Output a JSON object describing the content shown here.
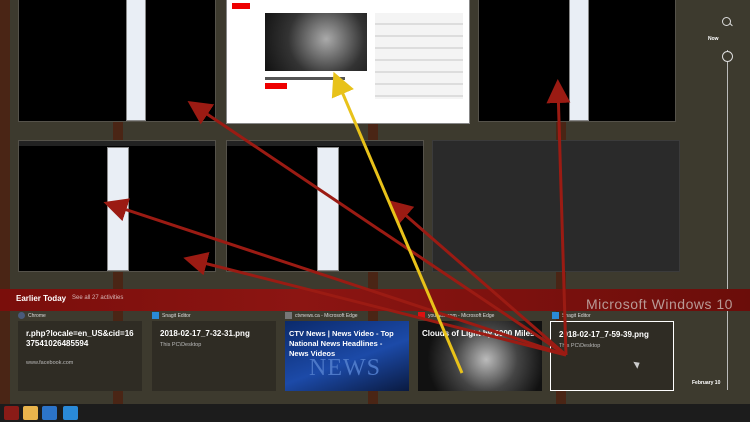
{
  "earlier_today": {
    "title": "Earlier Today",
    "see_all": "See all 27 activities",
    "brand": "Microsoft Windows 10"
  },
  "activities": [
    {
      "app": "Chrome",
      "title": "r.php?locale=en_US&cid=1637541026485594",
      "subtitle": "www.facebook.com"
    },
    {
      "app": "Snagit Editor",
      "title": "2018-02-17_7-32-31.png",
      "subtitle": "This PC\\Desktop"
    },
    {
      "app": "ctvnews.ca - Microsoft Edge",
      "title": "CTV News | News Video - Top National News Headlines - News Videos",
      "subtitle": ""
    },
    {
      "app": "youtube.com - Microsoft Edge",
      "title": "Clouds of Light by 6000 Miles",
      "subtitle": ""
    },
    {
      "app": "Snagit Editor",
      "title": "2018-02-17_7-59-39.png",
      "subtitle": "This PC\\Desktop"
    }
  ],
  "news_image_text": "NEWS",
  "timeline": {
    "now_label": "Now",
    "date_label": "February 10"
  },
  "colors": {
    "band": "#8c1512",
    "arrow_red": "#9b1b13",
    "arrow_yellow": "#e8c21a"
  },
  "icons": [
    "search-icon",
    "chrome-icon",
    "snagit-icon",
    "edge-icon",
    "youtube-icon"
  ]
}
